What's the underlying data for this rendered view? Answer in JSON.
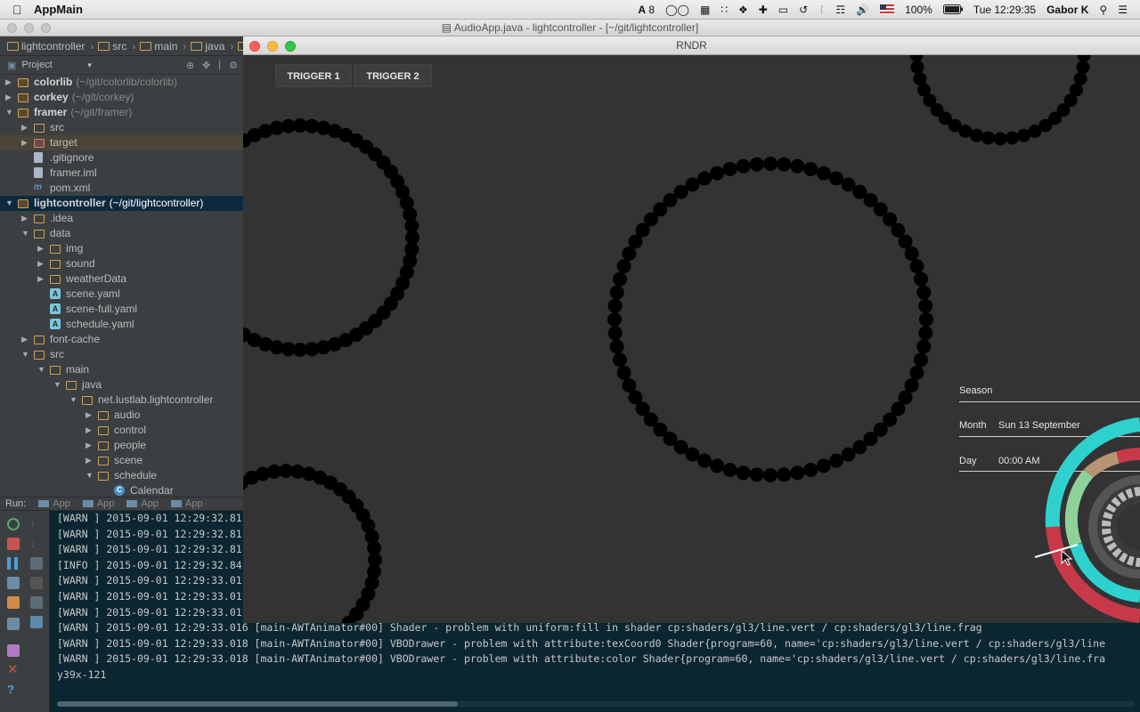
{
  "menubar": {
    "app_name": "AppMain",
    "battery": "100%",
    "adobe_count": "8",
    "clock": "Tue 12:29:35",
    "user": "Gabor K"
  },
  "ide": {
    "title": "AudioApp.java - lightcontroller - [~/git/lightcontroller]",
    "breadcrumb": [
      "lightcontroller",
      "src",
      "main",
      "java"
    ]
  },
  "project": {
    "header_label": "Project",
    "tree": [
      {
        "label": "colorlib",
        "path": "(~/git/colorlib/colorlib)",
        "depth": 0,
        "arrow": "▶",
        "icon": "module"
      },
      {
        "label": "corkey",
        "path": "(~/git/corkey)",
        "depth": 0,
        "arrow": "▶",
        "icon": "module"
      },
      {
        "label": "framer",
        "path": "(~/git/framer)",
        "depth": 0,
        "arrow": "▼",
        "icon": "module"
      },
      {
        "label": "src",
        "path": "",
        "depth": 1,
        "arrow": "▶",
        "icon": "folder"
      },
      {
        "label": "target",
        "path": "",
        "depth": 1,
        "arrow": "▶",
        "icon": "folder-pink",
        "state": "target"
      },
      {
        "label": ".gitignore",
        "path": "",
        "depth": 1,
        "arrow": "",
        "icon": "file"
      },
      {
        "label": "framer.iml",
        "path": "",
        "depth": 1,
        "arrow": "",
        "icon": "file"
      },
      {
        "label": "pom.xml",
        "path": "",
        "depth": 1,
        "arrow": "",
        "icon": "maven"
      },
      {
        "label": "lightcontroller",
        "path": "(~/git/lightcontroller)",
        "depth": 0,
        "arrow": "▼",
        "icon": "module",
        "state": "selected"
      },
      {
        "label": ".idea",
        "path": "",
        "depth": 1,
        "arrow": "▶",
        "icon": "folder"
      },
      {
        "label": "data",
        "path": "",
        "depth": 1,
        "arrow": "▼",
        "icon": "folder"
      },
      {
        "label": "img",
        "path": "",
        "depth": 2,
        "arrow": "▶",
        "icon": "folder"
      },
      {
        "label": "sound",
        "path": "",
        "depth": 2,
        "arrow": "▶",
        "icon": "folder"
      },
      {
        "label": "weatherData",
        "path": "",
        "depth": 2,
        "arrow": "▶",
        "icon": "folder"
      },
      {
        "label": "scene.yaml",
        "path": "",
        "depth": 2,
        "arrow": "",
        "icon": "yaml"
      },
      {
        "label": "scene-full.yaml",
        "path": "",
        "depth": 2,
        "arrow": "",
        "icon": "yaml"
      },
      {
        "label": "schedule.yaml",
        "path": "",
        "depth": 2,
        "arrow": "",
        "icon": "yaml"
      },
      {
        "label": "font-cache",
        "path": "",
        "depth": 1,
        "arrow": "▶",
        "icon": "folder"
      },
      {
        "label": "src",
        "path": "",
        "depth": 1,
        "arrow": "▼",
        "icon": "folder"
      },
      {
        "label": "main",
        "path": "",
        "depth": 2,
        "arrow": "▼",
        "icon": "folder"
      },
      {
        "label": "java",
        "path": "",
        "depth": 3,
        "arrow": "▼",
        "icon": "folder"
      },
      {
        "label": "net.lustlab.lightcontroller",
        "path": "",
        "depth": 4,
        "arrow": "▼",
        "icon": "folder"
      },
      {
        "label": "audio",
        "path": "",
        "depth": 5,
        "arrow": "▶",
        "icon": "folder"
      },
      {
        "label": "control",
        "path": "",
        "depth": 5,
        "arrow": "▶",
        "icon": "folder"
      },
      {
        "label": "people",
        "path": "",
        "depth": 5,
        "arrow": "▶",
        "icon": "folder"
      },
      {
        "label": "scene",
        "path": "",
        "depth": 5,
        "arrow": "▶",
        "icon": "folder"
      },
      {
        "label": "schedule",
        "path": "",
        "depth": 5,
        "arrow": "▼",
        "icon": "folder"
      },
      {
        "label": "Calendar",
        "path": "",
        "depth": 6,
        "arrow": "",
        "icon": "class"
      }
    ]
  },
  "run": {
    "label": "Run:",
    "tabs": [
      "App",
      "App",
      "App",
      "App"
    ]
  },
  "console": {
    "lines": [
      "[WARN ] 2015-09-01 12:29:32.81",
      "[WARN ] 2015-09-01 12:29:32.81",
      "[WARN ] 2015-09-01 12:29:32.81",
      "[INFO ] 2015-09-01 12:29:32.84",
      "[WARN ] 2015-09-01 12:29:33.01",
      "[WARN ] 2015-09-01 12:29:33.01",
      "[WARN ] 2015-09-01 12:29:33.01",
      "[WARN ] 2015-09-01 12:29:33.016 [main-AWTAnimator#00] Shader - problem with uniform:fill in shader cp:shaders/gl3/line.vert / cp:shaders/gl3/line.frag",
      "[WARN ] 2015-09-01 12:29:33.018 [main-AWTAnimator#00] VBODrawer - problem with attribute:texCoord0 Shader{program=60, name='cp:shaders/gl3/line.vert / cp:shaders/gl3/line",
      "[WARN ] 2015-09-01 12:29:33.018 [main-AWTAnimator#00] VBODrawer - problem with attribute:color Shader{program=60, name='cp:shaders/gl3/line.vert / cp:shaders/gl3/line.fra",
      "y39x-121"
    ]
  },
  "rndr": {
    "title": "RNDR",
    "trigger1": "TRIGGER 1",
    "trigger2": "TRIGGER 2",
    "season_label": "Season",
    "month_label": "Month",
    "month_value": "Sun 13 September",
    "day_label": "Day",
    "day_value": "00:00 AM"
  },
  "colors": {
    "ide_bg": "#3c3f41",
    "selection": "#0d293e",
    "console_bg": "#0b2630",
    "canvas_bg": "#333333",
    "ring_cyan": "#2fd1cf",
    "ring_red": "#c8394a",
    "ring_green": "#8fd19b",
    "ring_tan": "#b79574"
  }
}
